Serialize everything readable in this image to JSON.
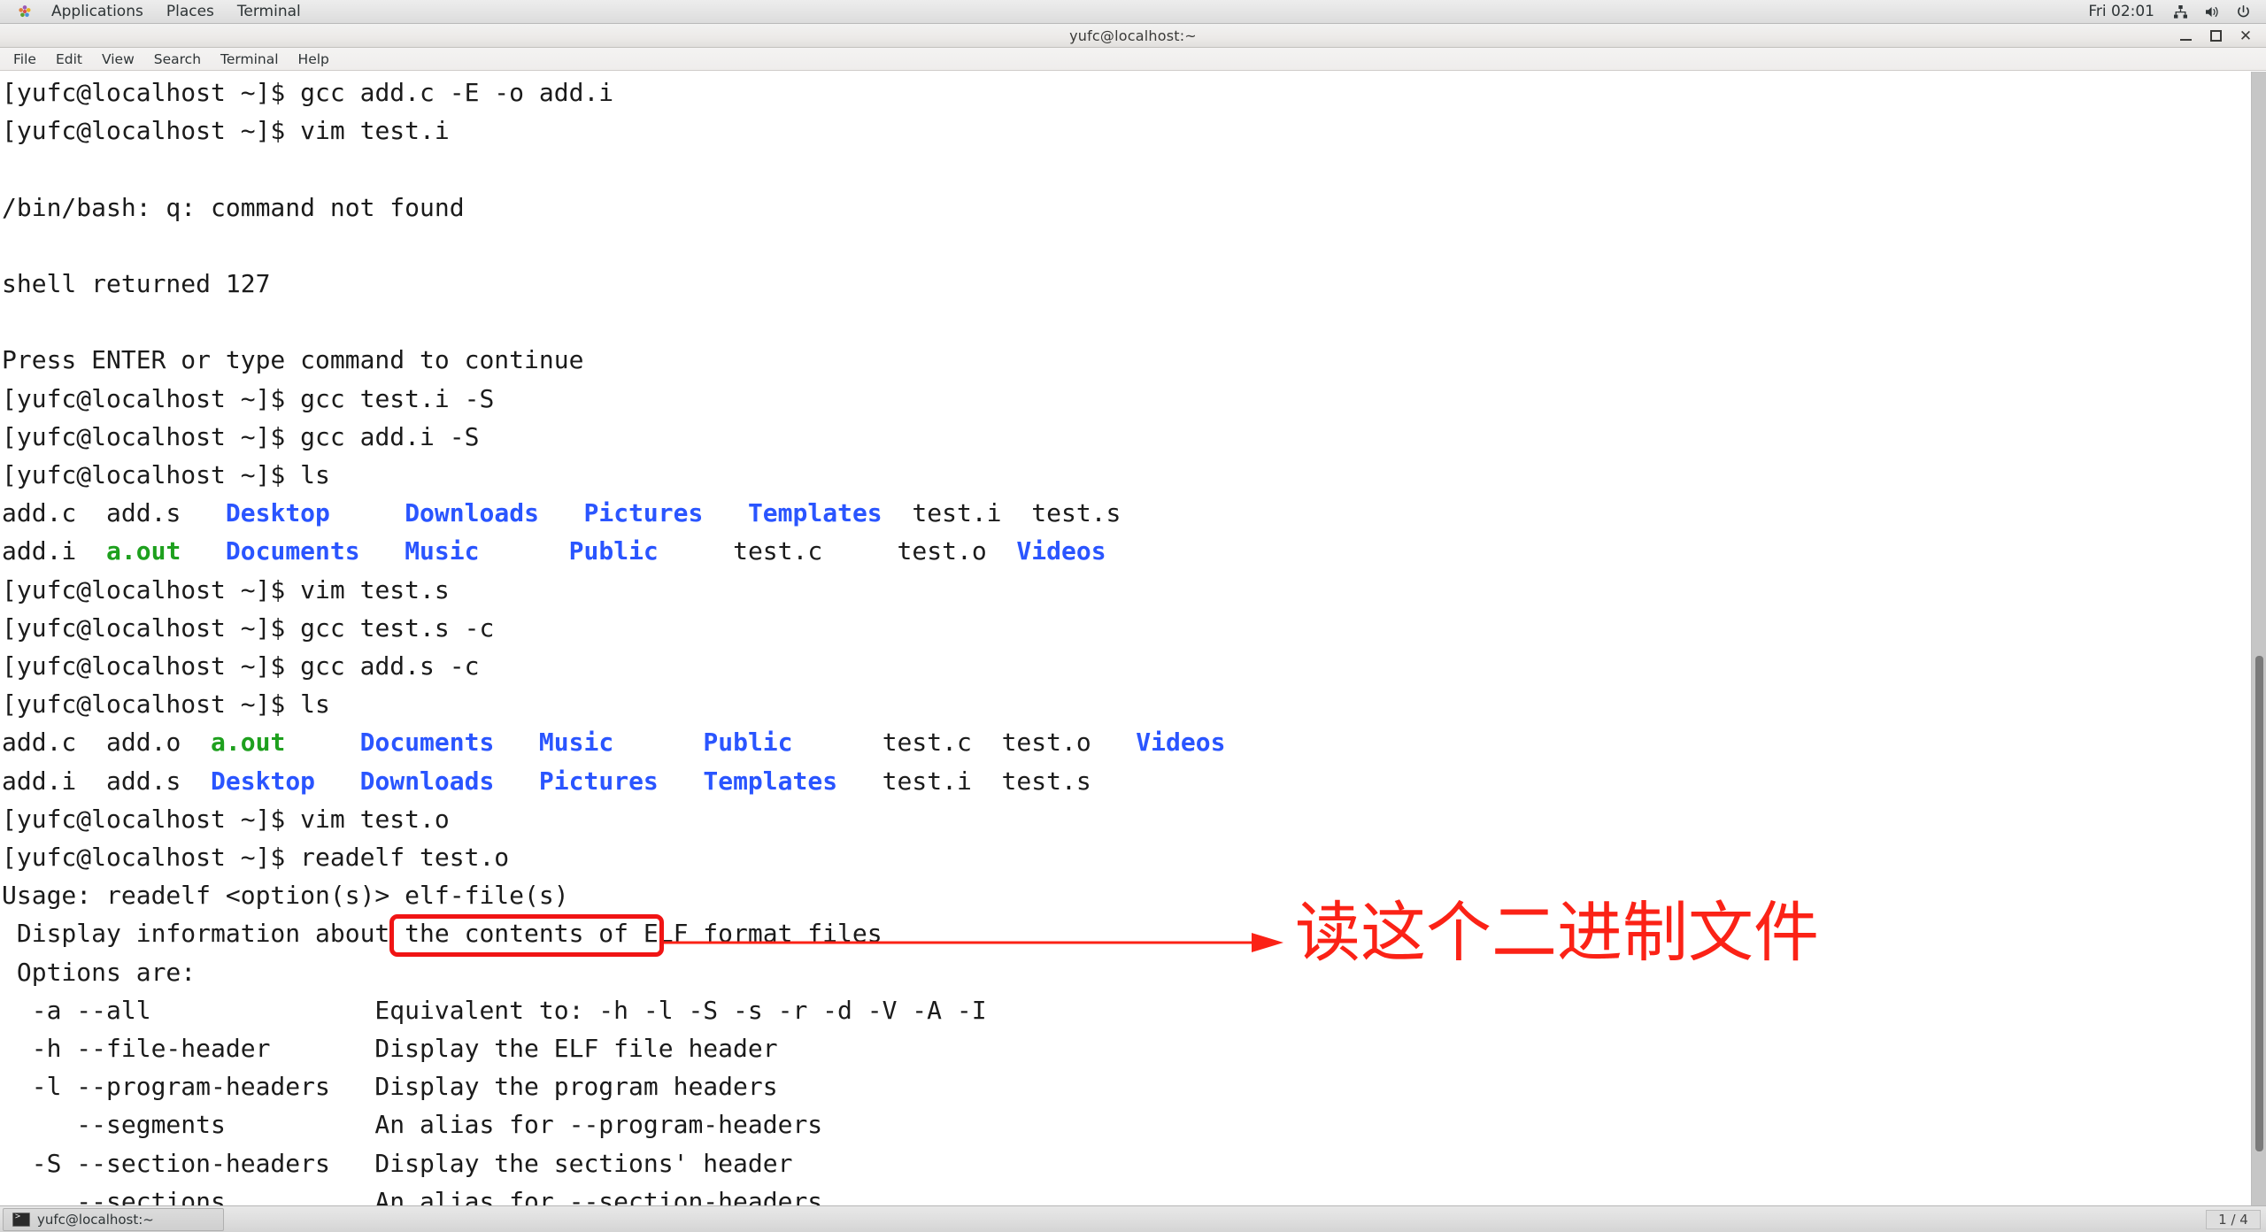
{
  "top_panel": {
    "applications_label": "Applications",
    "places_label": "Places",
    "terminal_label": "Terminal",
    "clock": "Fri 02:01",
    "icons": [
      "network-icon",
      "volume-icon",
      "power-icon"
    ]
  },
  "window": {
    "title": "yufc@localhost:~",
    "controls": {
      "minimize": "–",
      "maximize": "□",
      "close": "✕"
    }
  },
  "menubar": {
    "items": [
      {
        "label": "File"
      },
      {
        "label": "Edit"
      },
      {
        "label": "View"
      },
      {
        "label": "Search"
      },
      {
        "label": "Terminal"
      },
      {
        "label": "Help"
      }
    ]
  },
  "terminal": {
    "prompt": "[yufc@localhost ~]$ ",
    "lines": [
      {
        "type": "prompt",
        "command": "gcc add.c -E -o add.i"
      },
      {
        "type": "prompt",
        "command": "vim test.i"
      },
      {
        "type": "blank",
        "text": ""
      },
      {
        "type": "plain",
        "text": "/bin/bash: q: command not found"
      },
      {
        "type": "blank",
        "text": ""
      },
      {
        "type": "plain",
        "text": "shell returned 127"
      },
      {
        "type": "blank",
        "text": ""
      },
      {
        "type": "plain",
        "text": "Press ENTER or type command to continue"
      },
      {
        "type": "prompt",
        "command": "gcc test.i -S"
      },
      {
        "type": "prompt",
        "command": "gcc add.i -S"
      },
      {
        "type": "prompt",
        "command": "ls"
      },
      {
        "type": "ls",
        "cells": [
          {
            "text": "add.c",
            "color": "plain"
          },
          {
            "text": "  ",
            "color": "plain"
          },
          {
            "text": "add.s",
            "color": "plain"
          },
          {
            "text": "   ",
            "color": "plain"
          },
          {
            "text": "Desktop",
            "color": "blue"
          },
          {
            "text": "     ",
            "color": "plain"
          },
          {
            "text": "Downloads",
            "color": "blue"
          },
          {
            "text": "   ",
            "color": "plain"
          },
          {
            "text": "Pictures",
            "color": "blue"
          },
          {
            "text": "   ",
            "color": "plain"
          },
          {
            "text": "Templates",
            "color": "blue"
          },
          {
            "text": "  ",
            "color": "plain"
          },
          {
            "text": "test.i",
            "color": "plain"
          },
          {
            "text": "  ",
            "color": "plain"
          },
          {
            "text": "test.s",
            "color": "plain"
          }
        ]
      },
      {
        "type": "ls",
        "cells": [
          {
            "text": "add.i",
            "color": "plain"
          },
          {
            "text": "  ",
            "color": "plain"
          },
          {
            "text": "a.out",
            "color": "green"
          },
          {
            "text": "   ",
            "color": "plain"
          },
          {
            "text": "Documents",
            "color": "blue"
          },
          {
            "text": "   ",
            "color": "plain"
          },
          {
            "text": "Music",
            "color": "blue"
          },
          {
            "text": "      ",
            "color": "plain"
          },
          {
            "text": "Public",
            "color": "blue"
          },
          {
            "text": "     ",
            "color": "plain"
          },
          {
            "text": "test.c",
            "color": "plain"
          },
          {
            "text": "     ",
            "color": "plain"
          },
          {
            "text": "test.o",
            "color": "plain"
          },
          {
            "text": "  ",
            "color": "plain"
          },
          {
            "text": "Videos",
            "color": "blue"
          }
        ]
      },
      {
        "type": "prompt",
        "command": "vim test.s"
      },
      {
        "type": "prompt",
        "command": "gcc test.s -c"
      },
      {
        "type": "prompt",
        "command": "gcc add.s -c"
      },
      {
        "type": "prompt",
        "command": "ls"
      },
      {
        "type": "ls",
        "cells": [
          {
            "text": "add.c",
            "color": "plain"
          },
          {
            "text": "  ",
            "color": "plain"
          },
          {
            "text": "add.o",
            "color": "plain"
          },
          {
            "text": "  ",
            "color": "plain"
          },
          {
            "text": "a.out",
            "color": "green"
          },
          {
            "text": "     ",
            "color": "plain"
          },
          {
            "text": "Documents",
            "color": "blue"
          },
          {
            "text": "   ",
            "color": "plain"
          },
          {
            "text": "Music",
            "color": "blue"
          },
          {
            "text": "      ",
            "color": "plain"
          },
          {
            "text": "Public",
            "color": "blue"
          },
          {
            "text": "      ",
            "color": "plain"
          },
          {
            "text": "test.c",
            "color": "plain"
          },
          {
            "text": "  ",
            "color": "plain"
          },
          {
            "text": "test.o",
            "color": "plain"
          },
          {
            "text": "   ",
            "color": "plain"
          },
          {
            "text": "Videos",
            "color": "blue"
          }
        ]
      },
      {
        "type": "ls",
        "cells": [
          {
            "text": "add.i",
            "color": "plain"
          },
          {
            "text": "  ",
            "color": "plain"
          },
          {
            "text": "add.s",
            "color": "plain"
          },
          {
            "text": "  ",
            "color": "plain"
          },
          {
            "text": "Desktop",
            "color": "blue"
          },
          {
            "text": "   ",
            "color": "plain"
          },
          {
            "text": "Downloads",
            "color": "blue"
          },
          {
            "text": "   ",
            "color": "plain"
          },
          {
            "text": "Pictures",
            "color": "blue"
          },
          {
            "text": "   ",
            "color": "plain"
          },
          {
            "text": "Templates",
            "color": "blue"
          },
          {
            "text": "   ",
            "color": "plain"
          },
          {
            "text": "test.i",
            "color": "plain"
          },
          {
            "text": "  ",
            "color": "plain"
          },
          {
            "text": "test.s",
            "color": "plain"
          }
        ]
      },
      {
        "type": "prompt",
        "command": "vim test.o"
      },
      {
        "type": "prompt",
        "command": "readelf test.o"
      },
      {
        "type": "plain",
        "text": "Usage: readelf <option(s)> elf-file(s)"
      },
      {
        "type": "plain",
        "text": " Display information about the contents of ELF format files"
      },
      {
        "type": "plain",
        "text": " Options are:"
      },
      {
        "type": "plain",
        "text": "  -a --all               Equivalent to: -h -l -S -s -r -d -V -A -I"
      },
      {
        "type": "plain",
        "text": "  -h --file-header       Display the ELF file header"
      },
      {
        "type": "plain",
        "text": "  -l --program-headers   Display the program headers"
      },
      {
        "type": "plain",
        "text": "     --segments          An alias for --program-headers"
      },
      {
        "type": "plain",
        "text": "  -S --section-headers   Display the sections' header"
      },
      {
        "type": "plain",
        "text": "     --sections          An alias for --section-headers"
      }
    ]
  },
  "annotation": {
    "highlighted_command": "readelf test.o",
    "note_text": "读这个二进制文件",
    "color": "#fb2216"
  },
  "bottom_panel": {
    "task_button_label": "yufc@localhost:~",
    "workspace_label": "1 / 4"
  },
  "colors": {
    "directory_blue": "#2a55ff",
    "executable_green": "#1ea01e",
    "text_black": "#1b1b1b",
    "annotation_red": "#fb2216",
    "terminal_background": "#ffffff"
  }
}
